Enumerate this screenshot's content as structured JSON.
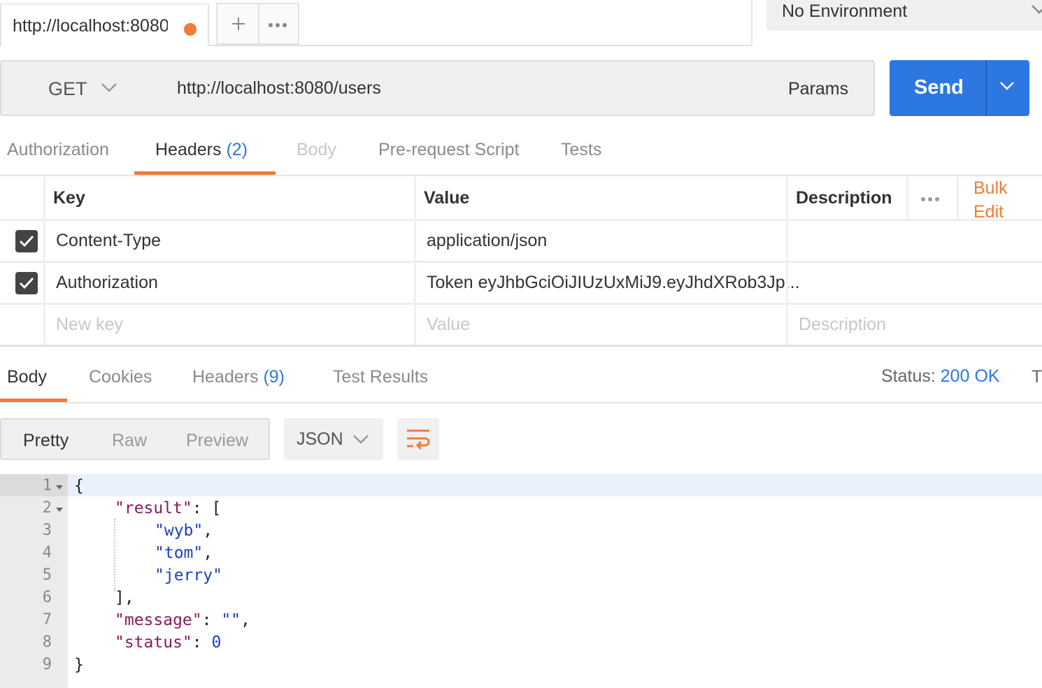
{
  "tabs": {
    "request_tab_label": "http://localhost:8080/users",
    "unsaved_dot_color": "#f07c37"
  },
  "environment": {
    "selected": "No Environment"
  },
  "request": {
    "method": "GET",
    "url": "http://localhost:8080/users",
    "params_label": "Params",
    "send_label": "Send"
  },
  "request_tabs": {
    "authorization": "Authorization",
    "headers": "Headers",
    "headers_count": "(2)",
    "body": "Body",
    "prerequest": "Pre-request Script",
    "tests": "Tests"
  },
  "headers_table": {
    "col_key": "Key",
    "col_value": "Value",
    "col_description": "Description",
    "bulk_edit_line1": "Bulk",
    "bulk_edit_line2": "Edit",
    "rows": [
      {
        "checked": true,
        "key": "Content-Type",
        "value": "application/json",
        "description": ""
      },
      {
        "checked": true,
        "key": "Authorization",
        "value": "Token eyJhbGciOiJIUzUxMiJ9.eyJhdXRob3Jp...",
        "description": ""
      }
    ],
    "new_row": {
      "key_placeholder": "New key",
      "value_placeholder": "Value",
      "description_placeholder": "Description"
    }
  },
  "response_tabs": {
    "body": "Body",
    "cookies": "Cookies",
    "headers": "Headers",
    "headers_count": "(9)",
    "test_results": "Test Results",
    "status_label": "Status:",
    "status_value": "200 OK",
    "trailing": "T"
  },
  "response_toolbar": {
    "pretty": "Pretty",
    "raw": "Raw",
    "preview": "Preview",
    "format": "JSON"
  },
  "response_body": {
    "line_numbers": [
      "1",
      "2",
      "3",
      "4",
      "5",
      "6",
      "7",
      "8",
      "9"
    ],
    "result_key": "\"result\"",
    "items": [
      "\"wyb\"",
      "\"tom\"",
      "\"jerry\""
    ],
    "message_key": "\"message\"",
    "message_value": "\"\"",
    "status_key": "\"status\"",
    "status_value": "0"
  },
  "colors": {
    "accent_orange": "#f07c37",
    "accent_blue": "#2d78e0"
  }
}
